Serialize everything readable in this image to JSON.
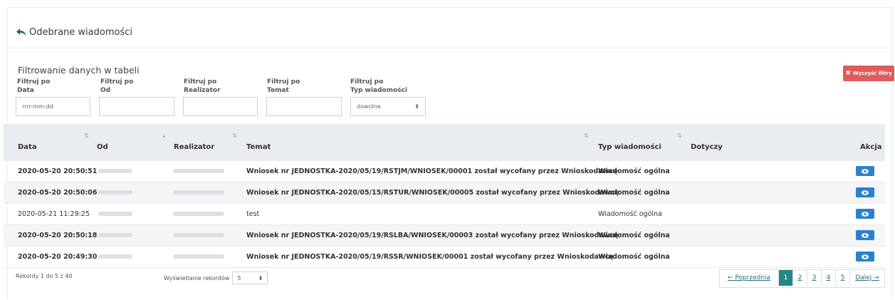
{
  "header": {
    "title": "Odebrane wiadomości"
  },
  "filters": {
    "title": "Filtrowanie danych w tabeli",
    "clear_label": "Wyczyść filtry",
    "fields": [
      {
        "line1": "Filtruj po",
        "line2": "Data",
        "placeholder": "rrrr-mm-dd",
        "value": ""
      },
      {
        "line1": "Filtruj po",
        "line2": "Od",
        "placeholder": "",
        "value": ""
      },
      {
        "line1": "Filtruj po",
        "line2": "Realizator",
        "placeholder": "",
        "value": ""
      },
      {
        "line1": "Filtruj po",
        "line2": "Temat",
        "placeholder": "",
        "value": ""
      },
      {
        "line1": "Filtruj po",
        "line2": "Typ wiadomości",
        "placeholder": "",
        "value": "dowolne"
      }
    ]
  },
  "table": {
    "columns": [
      "Data",
      "Od",
      "Realizator",
      "Temat",
      "Typ wiadomości",
      "Dotyczy",
      "Akcja"
    ],
    "rows": [
      {
        "data": "2020-05-20 20:50:51",
        "temat": "Wniosek nr JEDNOSTKA-2020/05/19/RSTJM/WNIOSEK/00001 został wycofany przez Wnioskodawcę",
        "typ": "Wiadomość ogólna",
        "unread": true
      },
      {
        "data": "2020-05-20 20:50:06",
        "temat": "Wniosek nr JEDNOSTKA-2020/05/15/RSTUR/WNIOSEK/00005 został wycofany przez Wnioskodawcę",
        "typ": "Wiadomość ogólna",
        "unread": true
      },
      {
        "data": "2020-05-21 11:29:25",
        "temat": "test",
        "typ": "Wiadomość ogólna",
        "unread": false
      },
      {
        "data": "2020-05-20 20:50:18",
        "temat": "Wniosek nr JEDNOSTKA-2020/05/19/RSLBA/WNIOSEK/00003 został wycofany przez Wnioskodawcę",
        "typ": "Wiadomość ogólna",
        "unread": true
      },
      {
        "data": "2020-05-20 20:49:30",
        "temat": "Wniosek nr JEDNOSTKA-2020/05/19/RSSR/WNIOSEK/00001 został wycofany przez Wnioskodawcę",
        "typ": "Wiadomość ogólna",
        "unread": true
      }
    ]
  },
  "footer": {
    "records_info": "Rekordy 1 do 5 z 40",
    "per_page_label": "Wyświetlanie rekordów",
    "per_page_value": "5",
    "pagination": {
      "prev": "← Poprzednia",
      "pages": [
        "1",
        "2",
        "3",
        "4",
        "5"
      ],
      "active": "1",
      "next": "Dalej →"
    }
  },
  "colors": {
    "clear_button": "#e15b5b",
    "view_button": "#2b82cb",
    "active_page": "#26868a",
    "table_header": "#e9ecf0"
  }
}
